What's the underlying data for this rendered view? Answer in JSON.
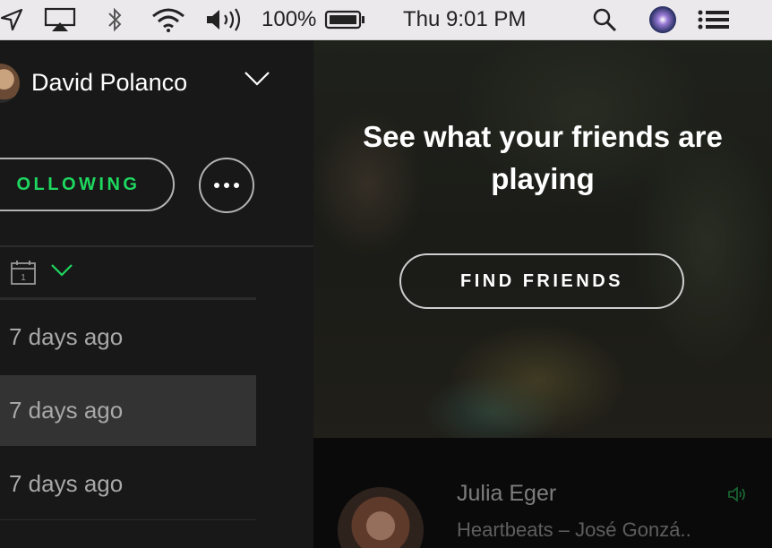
{
  "menubar": {
    "battery_percent": "100%",
    "clock": "Thu 9:01 PM"
  },
  "user": {
    "name": "David Polanco"
  },
  "actions": {
    "following_label": "OLLOWING"
  },
  "list": {
    "items": [
      {
        "label": "7 days ago",
        "selected": false
      },
      {
        "label": "7 days ago",
        "selected": true
      },
      {
        "label": "7 days ago",
        "selected": false
      }
    ]
  },
  "friends_panel": {
    "title": "See what your friends are playing",
    "find_friends_label": "FIND FRIENDS",
    "friend": {
      "name": "Julia Eger",
      "track": "Heartbeats – José Gonzá.."
    }
  },
  "colors": {
    "accent_green": "#1ed760",
    "panel_bg": "#181818",
    "selected_row": "#333333"
  },
  "icons": [
    "location-arrow-icon",
    "airplay-icon",
    "bluetooth-icon",
    "wifi-icon",
    "volume-icon",
    "battery-icon",
    "spotlight-search-icon",
    "siri-icon",
    "notification-center-icon",
    "chevron-down-icon",
    "more-icon",
    "calendar-icon",
    "speaker-playing-icon"
  ]
}
